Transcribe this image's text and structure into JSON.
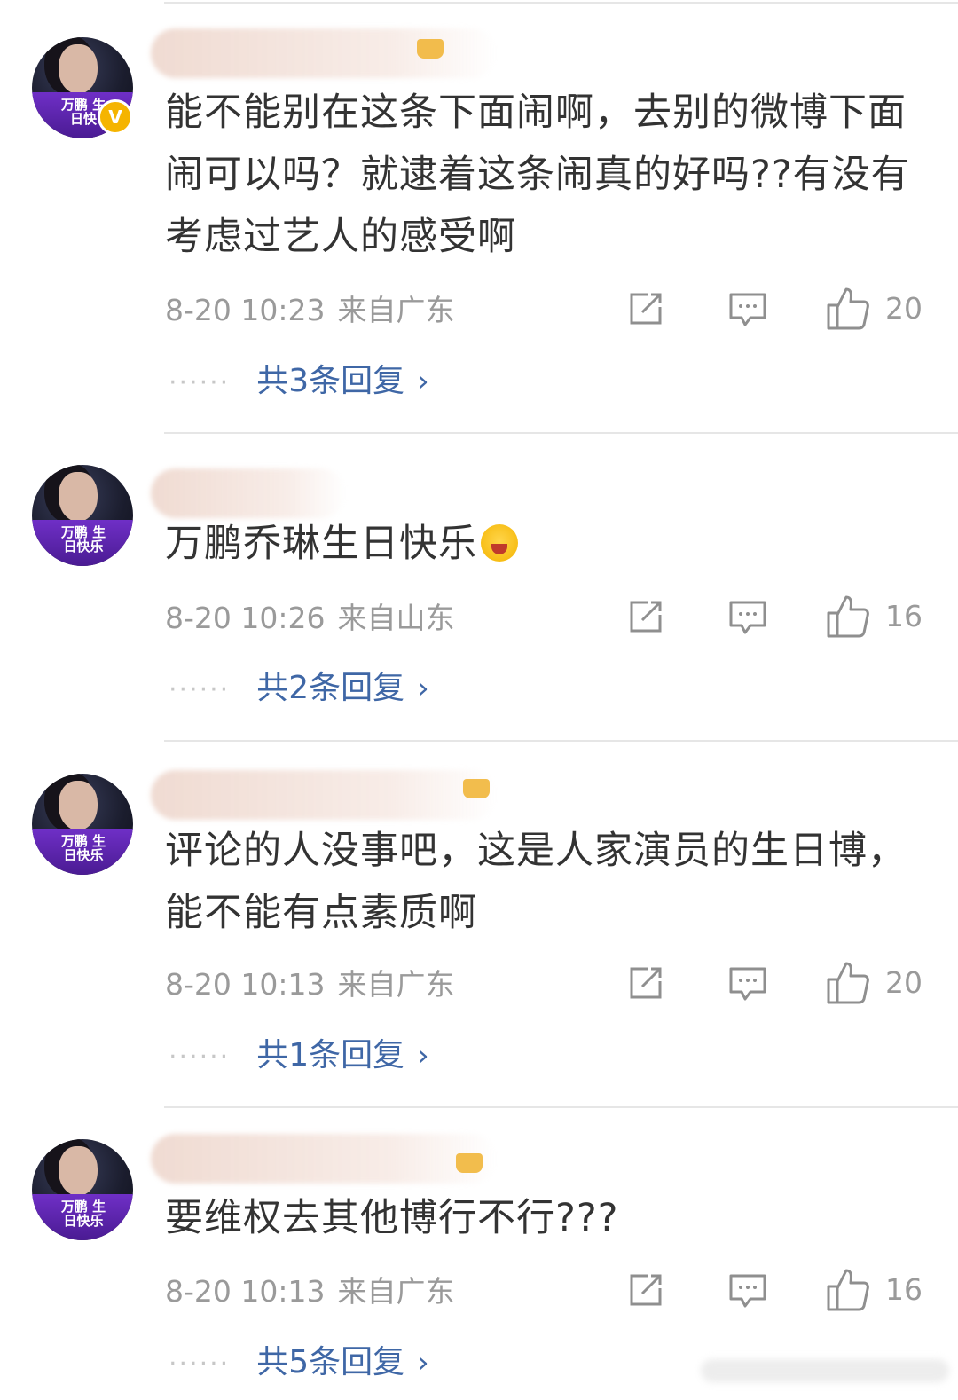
{
  "comments": [
    {
      "text": "能不能别在这条下面闹啊，去别的微博下面闹可以吗？就逮着这条闹真的好吗??有没有考虑过艺人的感受啊",
      "time": "8-20 10:23",
      "location": "来自广东",
      "likes": "20",
      "replies": "共3条回复",
      "avatar_text": "万鹏 生日快",
      "verified": true
    },
    {
      "text": "万鹏乔琳生日快乐",
      "time": "8-20 10:26",
      "location": "来自山东",
      "likes": "16",
      "replies": "共2条回复",
      "avatar_text": "万鹏 生日快乐",
      "emoji": "laugh-cry-emoji"
    },
    {
      "text": "评论的人没事吧，这是人家演员的生日博，能不能有点素质啊",
      "time": "8-20 10:13",
      "location": "来自广东",
      "likes": "20",
      "replies": "共1条回复",
      "avatar_text": "万鹏 生日快乐"
    },
    {
      "text": "要维权去其他博行不行???",
      "time": "8-20 10:13",
      "location": "来自广东",
      "likes": "16",
      "replies": "共5条回复",
      "avatar_text": "万鹏 生日快乐"
    }
  ],
  "icons": {
    "share": "share-icon",
    "comment": "comment-icon",
    "like": "thumbs-up-icon",
    "chevron": "chevron-right-icon"
  },
  "ui": {
    "dots": "······",
    "chevron_glyph": "›"
  },
  "colors": {
    "text": "#333333",
    "meta": "#9a9a9a",
    "link": "#3f67a6",
    "avatar_band": "#6f2fc7",
    "verified": "#f5b400"
  }
}
